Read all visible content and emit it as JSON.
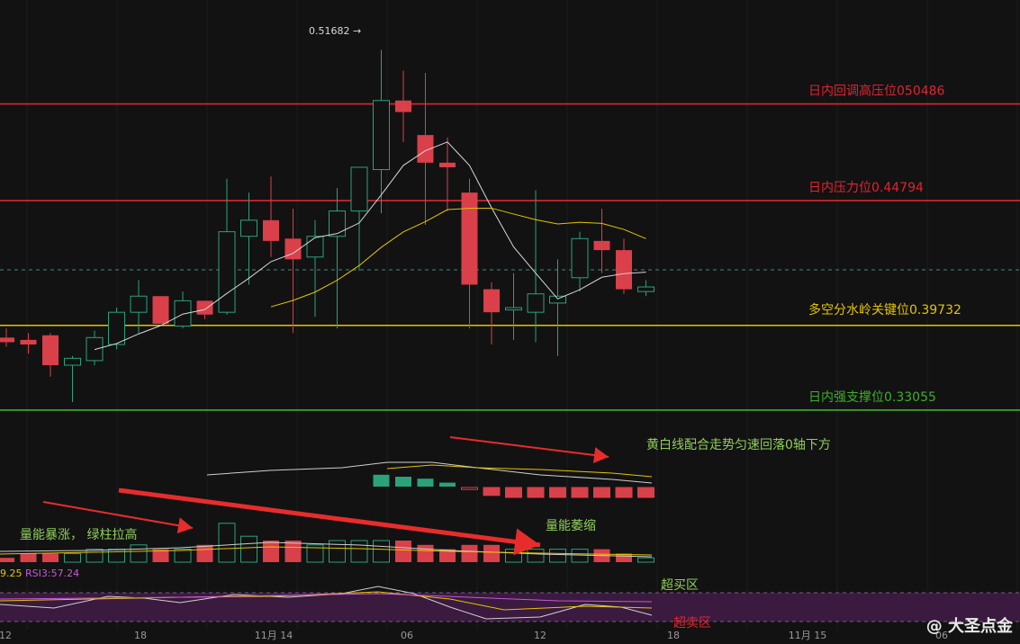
{
  "chart_data": {
    "type": "candlestick",
    "max_label": "0.51682",
    "candles": [
      {
        "o": 0.392,
        "h": 0.396,
        "l": 0.388,
        "c": 0.39
      },
      {
        "o": 0.391,
        "h": 0.394,
        "l": 0.385,
        "c": 0.389
      },
      {
        "o": 0.393,
        "h": 0.394,
        "l": 0.375,
        "c": 0.38
      },
      {
        "o": 0.38,
        "h": 0.384,
        "l": 0.364,
        "c": 0.383
      },
      {
        "o": 0.382,
        "h": 0.395,
        "l": 0.38,
        "c": 0.392
      },
      {
        "o": 0.389,
        "h": 0.405,
        "l": 0.387,
        "c": 0.403
      },
      {
        "o": 0.403,
        "h": 0.417,
        "l": 0.394,
        "c": 0.41
      },
      {
        "o": 0.41,
        "h": 0.41,
        "l": 0.4,
        "c": 0.398
      },
      {
        "o": 0.397,
        "h": 0.412,
        "l": 0.396,
        "c": 0.408
      },
      {
        "o": 0.408,
        "h": 0.408,
        "l": 0.4,
        "c": 0.402
      },
      {
        "o": 0.403,
        "h": 0.461,
        "l": 0.402,
        "c": 0.438
      },
      {
        "o": 0.436,
        "h": 0.455,
        "l": 0.415,
        "c": 0.443
      },
      {
        "o": 0.443,
        "h": 0.462,
        "l": 0.427,
        "c": 0.434
      },
      {
        "o": 0.435,
        "h": 0.448,
        "l": 0.394,
        "c": 0.426
      },
      {
        "o": 0.427,
        "h": 0.443,
        "l": 0.401,
        "c": 0.436
      },
      {
        "o": 0.436,
        "h": 0.457,
        "l": 0.396,
        "c": 0.447
      },
      {
        "o": 0.447,
        "h": 0.456,
        "l": 0.421,
        "c": 0.466
      },
      {
        "o": 0.465,
        "h": 0.517,
        "l": 0.446,
        "c": 0.495
      },
      {
        "o": 0.495,
        "h": 0.508,
        "l": 0.477,
        "c": 0.49
      },
      {
        "o": 0.48,
        "h": 0.507,
        "l": 0.441,
        "c": 0.468
      },
      {
        "o": 0.468,
        "h": 0.479,
        "l": 0.447,
        "c": 0.466
      },
      {
        "o": 0.455,
        "h": 0.461,
        "l": 0.396,
        "c": 0.415
      },
      {
        "o": 0.413,
        "h": 0.416,
        "l": 0.389,
        "c": 0.403
      },
      {
        "o": 0.404,
        "h": 0.42,
        "l": 0.391,
        "c": 0.405
      },
      {
        "o": 0.403,
        "h": 0.456,
        "l": 0.39,
        "c": 0.411
      },
      {
        "o": 0.407,
        "h": 0.426,
        "l": 0.384,
        "c": 0.41
      },
      {
        "o": 0.418,
        "h": 0.438,
        "l": 0.412,
        "c": 0.435
      },
      {
        "o": 0.434,
        "h": 0.448,
        "l": 0.42,
        "c": 0.43
      },
      {
        "o": 0.43,
        "h": 0.435,
        "l": 0.411,
        "c": 0.413
      },
      {
        "o": 0.412,
        "h": 0.417,
        "l": 0.41,
        "c": 0.414
      }
    ],
    "levels": [
      {
        "label": "日内回调高压位050486",
        "value": 0.4935,
        "color": "#e0242f"
      },
      {
        "label": "日内压力位0.44794",
        "value": 0.4515,
        "color": "#e0242f"
      },
      {
        "label": "多空分水岭关键位0.39732",
        "value": 0.3973,
        "color": "#e5c400"
      },
      {
        "label": "日内强支撑位0.33055",
        "value": 0.3605,
        "color": "#3fae2a"
      }
    ],
    "annotations": {
      "macd_note": "黄白线配合走势匀速回落0轴下方",
      "vol_surge": "量能暴涨， 绿柱拉高",
      "vol_shrink": "量能萎缩",
      "overbought": "超买区",
      "oversold": "超卖区"
    },
    "rsi_label": "RSI3:57.24",
    "rsi_prefix": "9.25",
    "xaxis": [
      "12",
      "18",
      "11月 14",
      "06",
      "12",
      "18",
      "11月 15",
      "06"
    ],
    "volume": [
      1,
      2,
      2,
      2,
      3,
      3,
      4,
      3,
      3,
      4,
      9,
      6,
      5,
      5,
      4,
      5,
      5,
      5,
      5,
      4,
      3,
      4,
      4,
      3,
      3,
      3,
      3,
      3,
      2,
      1
    ],
    "macd": [
      0,
      0,
      0,
      0,
      0,
      0,
      0,
      0,
      0,
      0,
      0,
      0,
      0,
      0,
      0,
      0,
      0,
      6,
      5,
      4,
      2,
      -1,
      -4,
      -5,
      -5,
      -5,
      -5,
      -5,
      -5,
      -5
    ]
  },
  "watermark": "@ 大圣点金",
  "colors": {
    "up": "#2aa27c",
    "down": "#d9404a",
    "bg": "#121212"
  }
}
